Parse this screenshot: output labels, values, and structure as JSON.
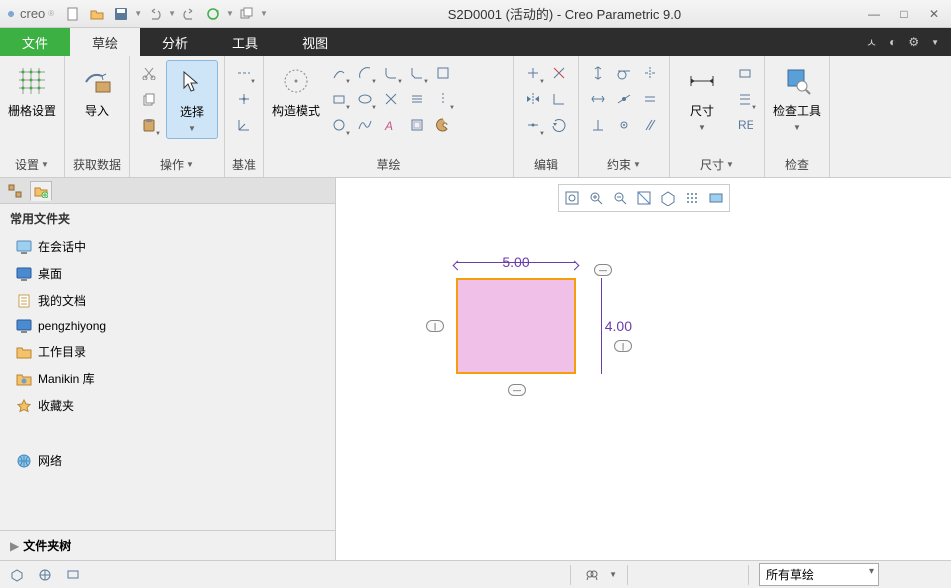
{
  "app": {
    "brand": "creo",
    "title": "S2D0001 (活动的) - Creo Parametric 9.0"
  },
  "menu": {
    "file": "文件",
    "sketch": "草绘",
    "analysis": "分析",
    "tools": "工具",
    "view": "视图"
  },
  "ribbon": {
    "grid": {
      "btn": "栅格设置",
      "label": "设置"
    },
    "import": {
      "btn": "导入",
      "label": "获取数据"
    },
    "select": {
      "btn": "选择",
      "label": "操作"
    },
    "datum": {
      "label": "基准"
    },
    "construct": {
      "btn": "构造模式",
      "label": "草绘"
    },
    "edit": {
      "label": "编辑"
    },
    "constrain": {
      "label": "约束"
    },
    "dimension": {
      "btn": "尺寸",
      "label": "尺寸"
    },
    "inspect": {
      "btn": "检查工具",
      "label": "检查"
    }
  },
  "sidebar": {
    "header": "常用文件夹",
    "items": [
      {
        "label": "在会话中"
      },
      {
        "label": "桌面"
      },
      {
        "label": "我的文档"
      },
      {
        "label": "pengzhiyong"
      },
      {
        "label": "工作目录"
      },
      {
        "label": "Manikin 库"
      },
      {
        "label": "收藏夹"
      },
      {
        "label": "网络"
      }
    ],
    "footer": "文件夹树"
  },
  "sketchdata": {
    "width_dim": "5.00",
    "height_dim": "4.00"
  },
  "status": {
    "filter": "所有草绘"
  }
}
